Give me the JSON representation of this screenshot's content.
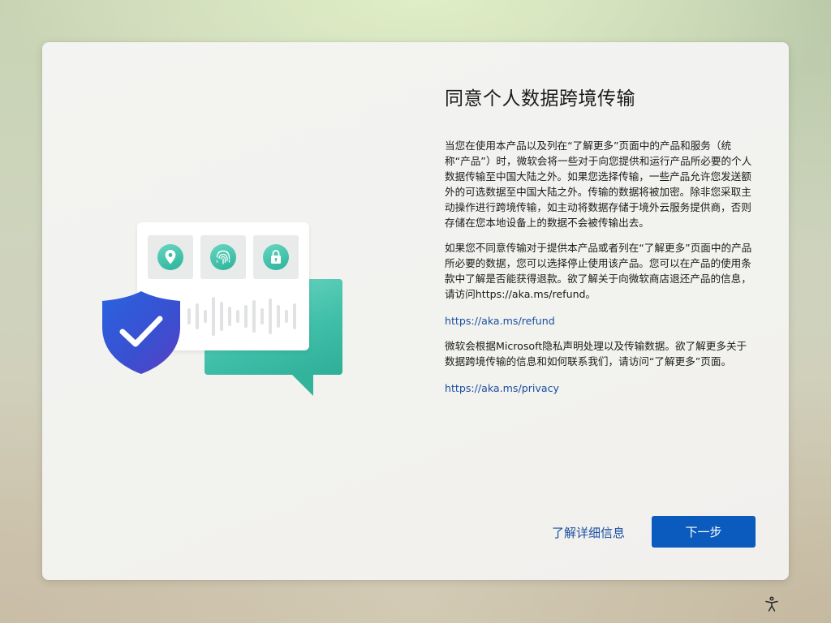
{
  "dialog": {
    "title": "同意个人数据跨境传输",
    "paragraphs": [
      "当您在使用本产品以及列在“了解更多”页面中的产品和服务（统称“产品”）时，微软会将一些对于向您提供和运行产品所必要的个人数据传输至中国大陆之外。如果您选择传输，一些产品允许您发送额外的可选数据至中国大陆之外。传输的数据将被加密。除非您采取主动操作进行跨境传输，如主动将数据存储于境外云服务提供商，否则存储在您本地设备上的数据不会被传输出去。",
      "如果您不同意传输对于提供本产品或者列在“了解更多”页面中的产品所必要的数据，您可以选择停止使用该产品。您可以在产品的使用条款中了解是否能获得退款。欲了解关于向微软商店退还产品的信息，请访问https://aka.ms/refund。",
      "微软会根据Microsoft隐私声明处理以及传输数据。欲了解更多关于数据跨境传输的信息和如何联系我们，请访问“了解更多”页面。"
    ],
    "links": {
      "refund": "https://aka.ms/refund",
      "privacy": "https://aka.ms/privacy"
    }
  },
  "footer": {
    "learn_more_label": "了解详细信息",
    "next_label": "下一步"
  },
  "illustration": {
    "icons": [
      "location-pin-icon",
      "fingerprint-icon",
      "padlock-icon",
      "checkmark-shield-icon",
      "sound-wave-icon",
      "chat-bubble-icon"
    ]
  },
  "system": {
    "accessibility_icon": "accessibility-icon"
  },
  "colors": {
    "accent": "#0a5bbd",
    "link": "#1a4fa0",
    "teal": "#3fbfa8",
    "shield_blue": "#2f55d4"
  }
}
